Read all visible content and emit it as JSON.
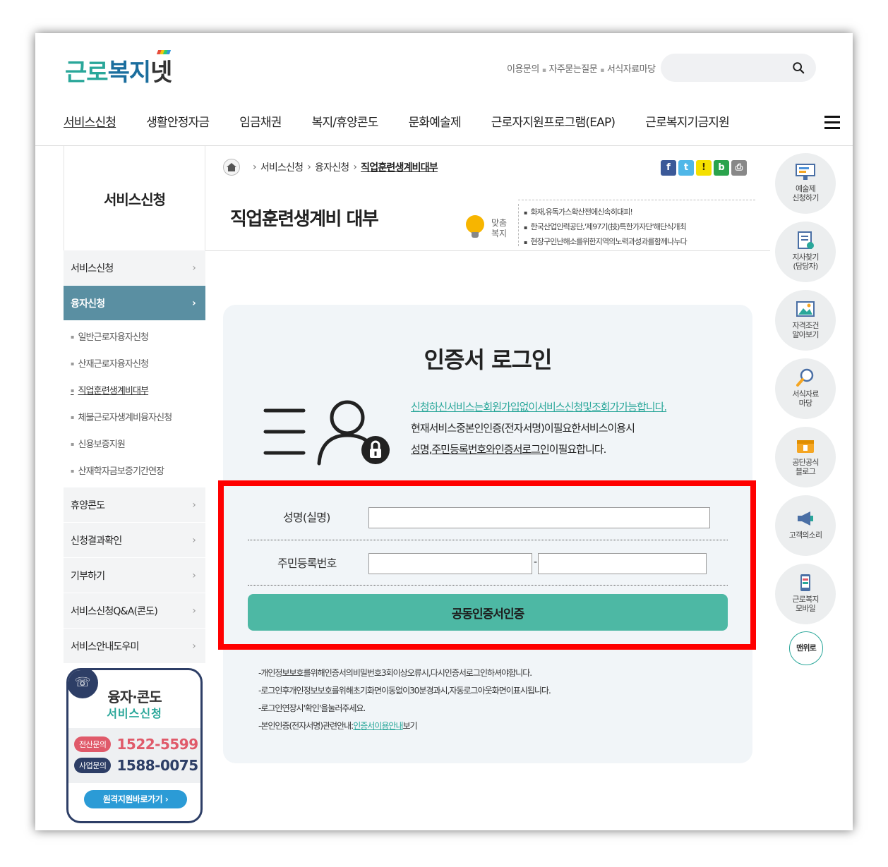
{
  "logo": {
    "part1": "근로",
    "part2": "복지",
    "part3": "넷"
  },
  "util_links": [
    "이용문의",
    "자주묻는질문",
    "서식자료마당"
  ],
  "search": {
    "placeholder": ""
  },
  "gnb": [
    "서비스신청",
    "생활안정자금",
    "임금채권",
    "복지/휴양콘도",
    "문화예술제",
    "근로자지원프로그램(EAP)",
    "근로복지기금지원"
  ],
  "lnb": {
    "title": "서비스신청",
    "items": [
      "서비스신청",
      "융자신청",
      "휴양콘도",
      "신청결과확인",
      "기부하기",
      "서비스신청Q&A(콘도)",
      "서비스안내도우미"
    ],
    "sub_items": [
      "일반근로자융자신청",
      "산재근로자융자신청",
      "직업훈련생계비대부",
      "체불근로자생계비융자신청",
      "신용보증지원",
      "산재학자금보증기간연장"
    ]
  },
  "banner": {
    "title": "융자·콘도",
    "subtitle": "서비스신청",
    "tel1_label": "전산문의",
    "tel1": "1522-5599",
    "tel2_label": "사업문의",
    "tel2": "1588-0075",
    "remote": "원격지원바로가기"
  },
  "breadcrumb": [
    "서비스신청",
    "융자신청",
    "직업훈련생계비대부"
  ],
  "page_title": "직업훈련생계비 대부",
  "custom": {
    "label1": "맞춤",
    "label2": "복지",
    "items": [
      "화재,유독가스확산전에신속히대피!",
      "한국산업인력공단,'제97기(技)특한가자단'해단식개최",
      "현장구인난해소를위한지역의노력과성과를함께나누다"
    ]
  },
  "login": {
    "title": "인증서 로그인",
    "desc_line1": "신청하신서비스는회원가입없이서비스신청및조회가가능합니다.",
    "desc_line2": "현재서비스중본인인증(전자서명)이필요한서비스이용시",
    "desc_line3_u": "성명,주민등록번호와인증서로그인",
    "desc_line3_rest": "이필요합니다.",
    "name_label": "성명(실명)",
    "rrn_label": "주민등록번호",
    "name_value": "",
    "rrn1_value": "",
    "rrn2_value": "",
    "hyphen": "-",
    "button": "공동인증서인증",
    "notes": [
      "-개인정보보호를위해인증서의비밀번호3회이상오류시,다시인증서로그인하셔야합니다.",
      "-로그인후개인정보보호를위해초기화면이동없이30분경과시,자동로그아웃화면이표시됩니다.",
      "-로그인연장시'확인'을눌러주세요."
    ],
    "note4_prefix": "-본인인증(전자서명)관련안내:",
    "note4_link": "인증서이용안내",
    "note4_suffix": "보기"
  },
  "quick_menu": [
    {
      "line1": "예술제",
      "line2": "신청하기"
    },
    {
      "line1": "지사찾기",
      "line2": "(담당자)"
    },
    {
      "line1": "자격조건",
      "line2": "알아보기"
    },
    {
      "line1": "서식자료",
      "line2": "마당"
    },
    {
      "line1": "공단공식",
      "line2": "블로그"
    },
    {
      "line1": "고객의소리",
      "line2": ""
    },
    {
      "line1": "근로복지",
      "line2": "모바일"
    }
  ],
  "top_button": "맨위로",
  "colors": {
    "accent": "#2aa79a",
    "lnb_active": "#5a8fa2",
    "button": "#4db8a4",
    "highlight_border": "#ff0000"
  }
}
